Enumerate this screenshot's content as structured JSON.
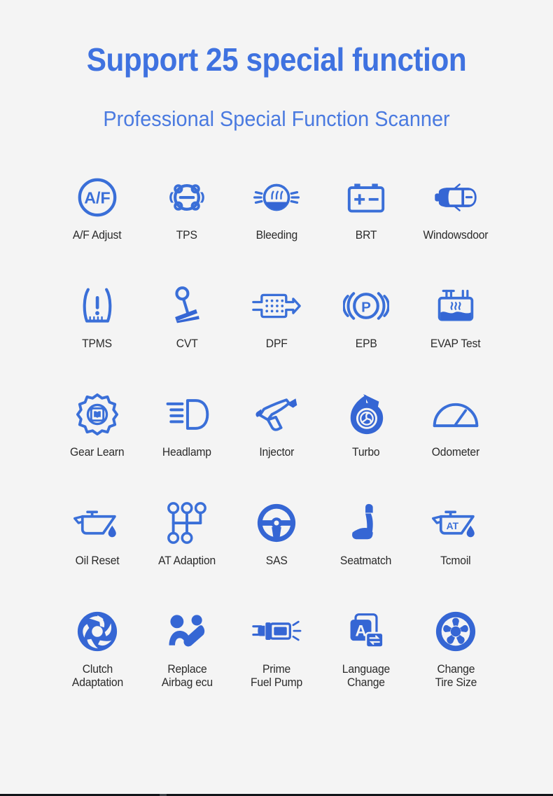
{
  "header": {
    "title": "Support 25 special function",
    "subtitle": "Professional Special Function Scanner"
  },
  "colors": {
    "background": "#f4f4f4",
    "title_blue": "#3f72e0",
    "subtitle_blue": "#4a7ae0",
    "icon_blue": "#3a6fd8",
    "icon_blue_dark": "#3566d4",
    "label_text": "#2b2b2b"
  },
  "functions": [
    {
      "label": "A/F Adjust",
      "icon": "af-adjust-icon"
    },
    {
      "label": "TPS",
      "icon": "tps-icon"
    },
    {
      "label": "Bleeding",
      "icon": "bleeding-icon"
    },
    {
      "label": "BRT",
      "icon": "brt-battery-icon"
    },
    {
      "label": "Windowsdoor",
      "icon": "windowsdoor-car-icon"
    },
    {
      "label": "TPMS",
      "icon": "tpms-tire-icon"
    },
    {
      "label": "CVT",
      "icon": "cvt-icon"
    },
    {
      "label": "DPF",
      "icon": "dpf-filter-icon"
    },
    {
      "label": "EPB",
      "icon": "epb-parking-brake-icon"
    },
    {
      "label": "EVAP Test",
      "icon": "evap-tank-icon"
    },
    {
      "label": "Gear Learn",
      "icon": "gear-learn-icon"
    },
    {
      "label": "Headlamp",
      "icon": "headlamp-icon"
    },
    {
      "label": "Injector",
      "icon": "injector-icon"
    },
    {
      "label": "Turbo",
      "icon": "turbo-icon"
    },
    {
      "label": "Odometer",
      "icon": "odometer-icon"
    },
    {
      "label": "Oil Reset",
      "icon": "oil-can-icon"
    },
    {
      "label": "AT Adaption",
      "icon": "at-adaption-shifter-icon"
    },
    {
      "label": "SAS",
      "icon": "steering-wheel-icon"
    },
    {
      "label": "Seatmatch",
      "icon": "car-seat-icon"
    },
    {
      "label": "Tcmoil",
      "icon": "at-oil-can-icon"
    },
    {
      "label": "Clutch\nAdaptation",
      "icon": "clutch-icon"
    },
    {
      "label": "Replace\nAirbag ecu",
      "icon": "airbag-icon"
    },
    {
      "label": "Prime\nFuel Pump",
      "icon": "fuel-pump-icon"
    },
    {
      "label": "Language\nChange",
      "icon": "language-change-icon"
    },
    {
      "label": "Change\nTire Size",
      "icon": "wheel-icon"
    }
  ]
}
